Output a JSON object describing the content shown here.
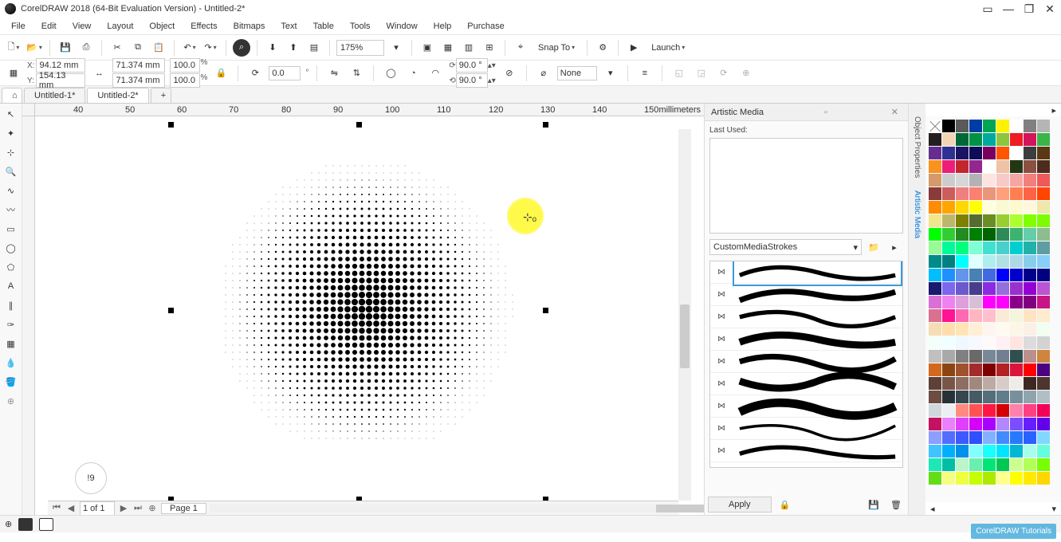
{
  "title": "CorelDRAW 2018 (64-Bit Evaluation Version) - Untitled-2*",
  "menu": [
    "File",
    "Edit",
    "View",
    "Layout",
    "Object",
    "Effects",
    "Bitmaps",
    "Text",
    "Table",
    "Tools",
    "Window",
    "Help",
    "Purchase"
  ],
  "toolbar1": {
    "zoom": "175%",
    "snap": "Snap To",
    "launch": "Launch"
  },
  "propbar": {
    "x": "94.12 mm",
    "y": "154.13 mm",
    "w": "71.374 mm",
    "h": "71.374 mm",
    "sx": "100.0",
    "sy": "100.0",
    "rot": "0.0",
    "ang1": "90.0 °",
    "ang2": "90.0 °",
    "outline": "None"
  },
  "tabs": {
    "t1": "Untitled-1*",
    "t2": "Untitled-2*"
  },
  "ruler_unit": "millimeters",
  "ruler_marks": [
    "40",
    "50",
    "60",
    "70",
    "80",
    "90",
    "100",
    "110",
    "120",
    "130",
    "140",
    "150"
  ],
  "docker": {
    "title": "Artistic Media",
    "last_used": "Last Used:",
    "category": "CustomMediaStrokes",
    "apply": "Apply"
  },
  "docker_tabs": [
    "Object Properties",
    "Artistic Media"
  ],
  "pagebar": {
    "page_of": "1 of 1",
    "page": "Page 1"
  },
  "hint": "!9",
  "watermark": "CorelDRAW\nTutorials",
  "palette": [
    "x",
    "#000000",
    "#5a5a5a",
    "#003ca6",
    "#00a651",
    "#fff200",
    "#ffffff",
    "#808080",
    "#b5b5b5",
    "#231f20",
    "#f3d5b5",
    "#006837",
    "#009245",
    "#00a99d",
    "#8cc63f",
    "#ed1c24",
    "#d4145a",
    "#39b54a",
    "#662d91",
    "#2e3192",
    "#1b1464",
    "#0e0b59",
    "#7a0060",
    "#ff5400",
    "#ffffff",
    "#3d3d3d",
    "#5b3813",
    "#f7931e",
    "#ed1e79",
    "#c1272d",
    "#93278f",
    "#ffffff",
    "#efc3a4",
    "#233714",
    "#8a5043",
    "#4d2c1d",
    "#d49a6a",
    "#cccccc",
    "#d6d6d6",
    "#b3b3b3",
    "#fde4e1",
    "#f7cac9",
    "#f4a6a3",
    "#f1807d",
    "#ee5a58",
    "#8b3a3a",
    "#cd5c5c",
    "#f08080",
    "#fa8072",
    "#e9967a",
    "#ffa07a",
    "#ff7f50",
    "#ff6347",
    "#ff4500",
    "#ff8c00",
    "#ffa500",
    "#ffd700",
    "#ffff00",
    "#ffffe0",
    "#fafad2",
    "#fffacd",
    "#fff8dc",
    "#eee8aa",
    "#f0e68c",
    "#bdb76b",
    "#808000",
    "#556b2f",
    "#6b8e23",
    "#9acd32",
    "#adff2f",
    "#7fff00",
    "#7cfc00",
    "#00ff00",
    "#32cd32",
    "#228b22",
    "#008000",
    "#006400",
    "#2e8b57",
    "#3cb371",
    "#66cdaa",
    "#8fbc8f",
    "#98fb98",
    "#00fa9a",
    "#00ff7f",
    "#7fffd4",
    "#40e0d0",
    "#48d1cc",
    "#00ced1",
    "#20b2aa",
    "#5f9ea0",
    "#008b8b",
    "#008080",
    "#00ffff",
    "#e0ffff",
    "#afeeee",
    "#b0e0e6",
    "#add8e6",
    "#87ceeb",
    "#87cefa",
    "#00bfff",
    "#1e90ff",
    "#6495ed",
    "#4682b4",
    "#4169e1",
    "#0000ff",
    "#0000cd",
    "#00008b",
    "#000080",
    "#191970",
    "#7b68ee",
    "#6a5acd",
    "#483d8b",
    "#8a2be2",
    "#9370db",
    "#9932cc",
    "#9400d3",
    "#ba55d3",
    "#da70d6",
    "#ee82ee",
    "#dda0dd",
    "#d8bfd8",
    "#ff00ff",
    "#ff00ff",
    "#8b008b",
    "#800080",
    "#c71585",
    "#db7093",
    "#ff1493",
    "#ff69b4",
    "#ffb6c1",
    "#ffc0cb",
    "#faebd7",
    "#f5f5dc",
    "#ffe4c4",
    "#ffebcd",
    "#f5deb3",
    "#ffdead",
    "#ffe4b5",
    "#ffefd5",
    "#fff5ee",
    "#fffaf0",
    "#fdf5e6",
    "#faf0e6",
    "#f0fff0",
    "#f5fffa",
    "#f0ffff",
    "#f0f8ff",
    "#f8f8ff",
    "#fffafa",
    "#fff0f5",
    "#ffe4e1",
    "#dcdcdc",
    "#d3d3d3",
    "#c0c0c0",
    "#a9a9a9",
    "#808080",
    "#696969",
    "#778899",
    "#708090",
    "#2f4f4f",
    "#bc8f8f",
    "#cd853f",
    "#d2691e",
    "#8b4513",
    "#a0522d",
    "#a52a2a",
    "#800000",
    "#b22222",
    "#dc143c",
    "#ff0000",
    "#4b0082",
    "#5d4037",
    "#795548",
    "#8d6e63",
    "#a1887f",
    "#bcaaa4",
    "#d7ccc8",
    "#efebe9",
    "#3e2723",
    "#4e342e",
    "#6d4c41",
    "#263238",
    "#37474f",
    "#455a64",
    "#546e7a",
    "#607d8b",
    "#78909c",
    "#90a4ae",
    "#b0bec5",
    "#cfd8dc",
    "#eceff1",
    "#ff8a80",
    "#ff5252",
    "#ff1744",
    "#d50000",
    "#ff80ab",
    "#ff4081",
    "#f50057",
    "#c51162",
    "#ea80fc",
    "#e040fb",
    "#d500f9",
    "#aa00ff",
    "#b388ff",
    "#7c4dff",
    "#651fff",
    "#6200ea",
    "#8c9eff",
    "#536dfe",
    "#3d5afe",
    "#304ffe",
    "#82b1ff",
    "#448aff",
    "#2979ff",
    "#2962ff",
    "#80d8ff",
    "#40c4ff",
    "#00b0ff",
    "#0091ea",
    "#84ffff",
    "#18ffff",
    "#00e5ff",
    "#00b8d4",
    "#a7ffeb",
    "#64ffda",
    "#1de9b6",
    "#00bfa5",
    "#b9f6ca",
    "#69f0ae",
    "#00e676",
    "#00c853",
    "#ccff90",
    "#b2ff59",
    "#76ff03",
    "#64dd17",
    "#f4ff81",
    "#eeff41",
    "#c6ff00",
    "#aeea00",
    "#ffff8d",
    "#ffff00",
    "#ffea00",
    "#ffd600"
  ]
}
